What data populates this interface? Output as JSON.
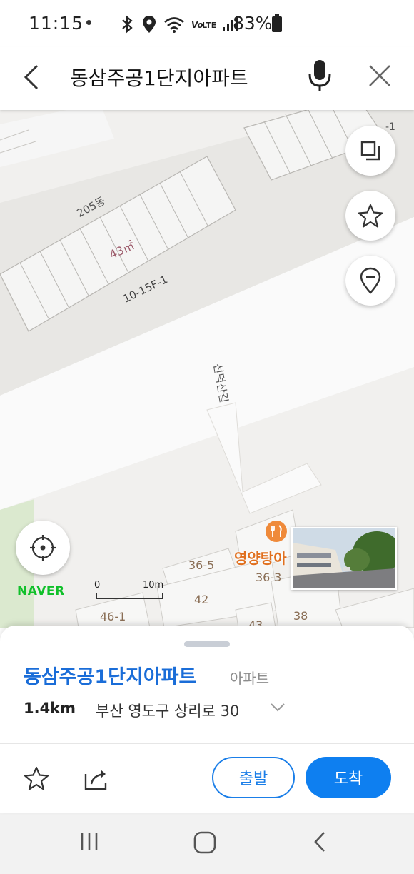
{
  "status_bar": {
    "time": "11:15",
    "battery": "83%",
    "network": "LTE"
  },
  "search": {
    "query": "동삼주공1단지아파트",
    "back_icon": "back-arrow-icon",
    "mic_icon": "mic-icon",
    "close_icon": "close-icon"
  },
  "map": {
    "labels": {
      "building_205": "205동",
      "area": "43㎡",
      "unit_code": "10-15F-1",
      "road": "선덕산길",
      "edge_label": "-1",
      "lot_36_5": "36-5",
      "lot_36_3": "36-3",
      "lot_42": "42",
      "lot_46_1": "46-1",
      "lot_38": "38",
      "lot_43": "43"
    },
    "poi": {
      "name": "영양탕아",
      "icon": "restaurant-icon"
    },
    "logo": "NAVER",
    "scale": {
      "zero": "0",
      "distance": "10m"
    },
    "buttons": {
      "layers": "layers-icon",
      "favorite": "star-icon",
      "place": "place-pin-icon",
      "locate": "locate-icon"
    }
  },
  "place": {
    "name": "동삼주공1단지아파트",
    "category": "아파트",
    "distance": "1.4km",
    "address": "부산 영도구 상리로 30"
  },
  "actions": {
    "depart": "출발",
    "arrive": "도착"
  },
  "colors": {
    "accent": "#0e7ff0",
    "naver_green": "#10c02a",
    "poi_orange": "#e0701f"
  }
}
